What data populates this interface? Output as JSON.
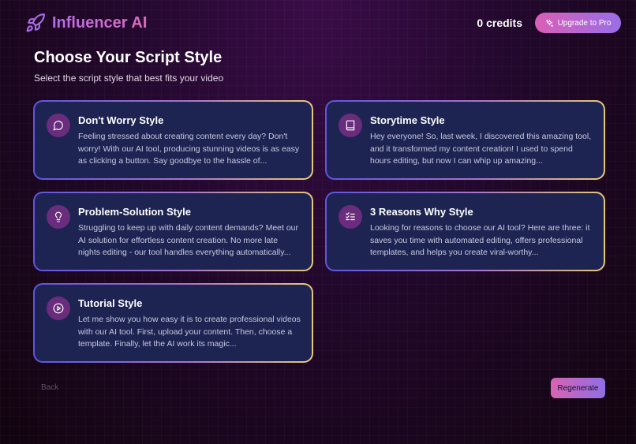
{
  "header": {
    "brand": "Influencer AI",
    "brand_icon": "rocket-icon",
    "credits": "0 credits",
    "upgrade_label": "Upgrade to Pro",
    "upgrade_icon": "sparkles-icon"
  },
  "page": {
    "title": "Choose Your Script Style",
    "subtitle": "Select the script style that best fits your video"
  },
  "styles": [
    {
      "title": "Don't Worry Style",
      "icon": "speech-bubble-icon",
      "description": "Feeling stressed about creating content every day? Don't worry! With our AI tool, producing stunning videos is as easy as clicking a button. Say goodbye to the hassle of..."
    },
    {
      "title": "Storytime Style",
      "icon": "book-icon",
      "description": "Hey everyone! So, last week, I discovered this amazing tool, and it transformed my content creation! I used to spend hours editing, but now I can whip up amazing..."
    },
    {
      "title": "Problem-Solution Style",
      "icon": "lightbulb-icon",
      "description": "Struggling to keep up with daily content demands? Meet our AI solution for effortless content creation. No more late nights editing - our tool handles everything automatically..."
    },
    {
      "title": "3 Reasons Why Style",
      "icon": "checklist-icon",
      "description": "Looking for reasons to choose our AI tool? Here are three: it saves you time with automated editing, offers professional templates, and helps you create viral-worthy..."
    },
    {
      "title": "Tutorial Style",
      "icon": "play-circle-icon",
      "description": "Let me show you how easy it is to create professional videos with our AI tool. First, upload your content. Then, choose a template. Finally, let the AI work its magic..."
    }
  ],
  "footer": {
    "back_label": "Back",
    "regenerate_label": "Regenerate"
  },
  "colors": {
    "accent_pink": "#d95fb6",
    "accent_purple": "#9a6ee8",
    "card_bg": "#1d2452",
    "card_border_start": "#5f55e0",
    "card_border_end": "#e6c878"
  }
}
